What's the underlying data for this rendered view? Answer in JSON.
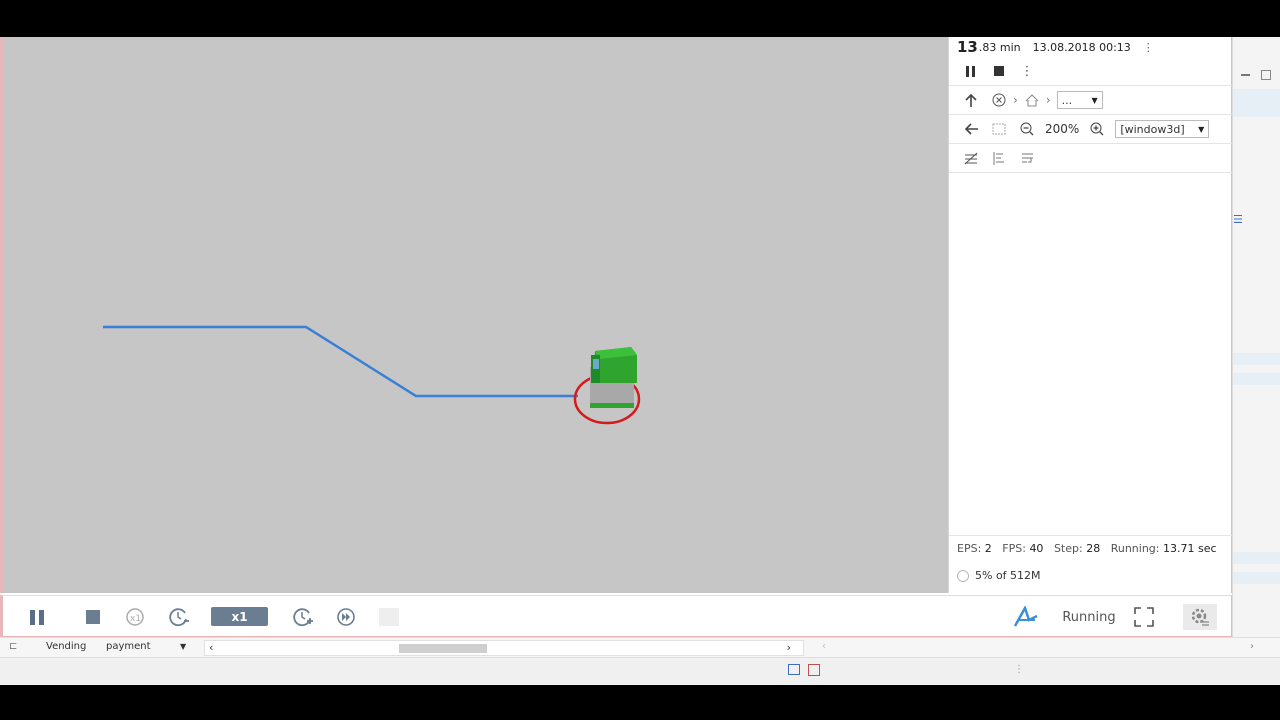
{
  "panel": {
    "time_big": "13",
    "time_rest": ".83 min",
    "datetime": "13.08.2018 00:13",
    "nav_select": "...",
    "zoom": "200%",
    "view_select": "[window3d]",
    "status": {
      "eps_label": "EPS:",
      "eps_value": "2",
      "fps_label": "FPS:",
      "fps_value": "40",
      "step_label": "Step:",
      "step_value": "28",
      "running_label": "Running:",
      "running_value": "13.71 sec"
    },
    "memory": "5% of 512M"
  },
  "toolbar": {
    "speed": "x1",
    "state": "Running"
  },
  "editor": {
    "left_label": "Vending",
    "select_value": "payment"
  },
  "colors": {
    "path": "#3a7fd6",
    "agent_top": "#2fa52f",
    "agent_body": "#a8a8a8",
    "selection_ring": "#d41a1a",
    "viewport_bg": "#c6c6c6",
    "speed_bg": "#6b7d90"
  }
}
